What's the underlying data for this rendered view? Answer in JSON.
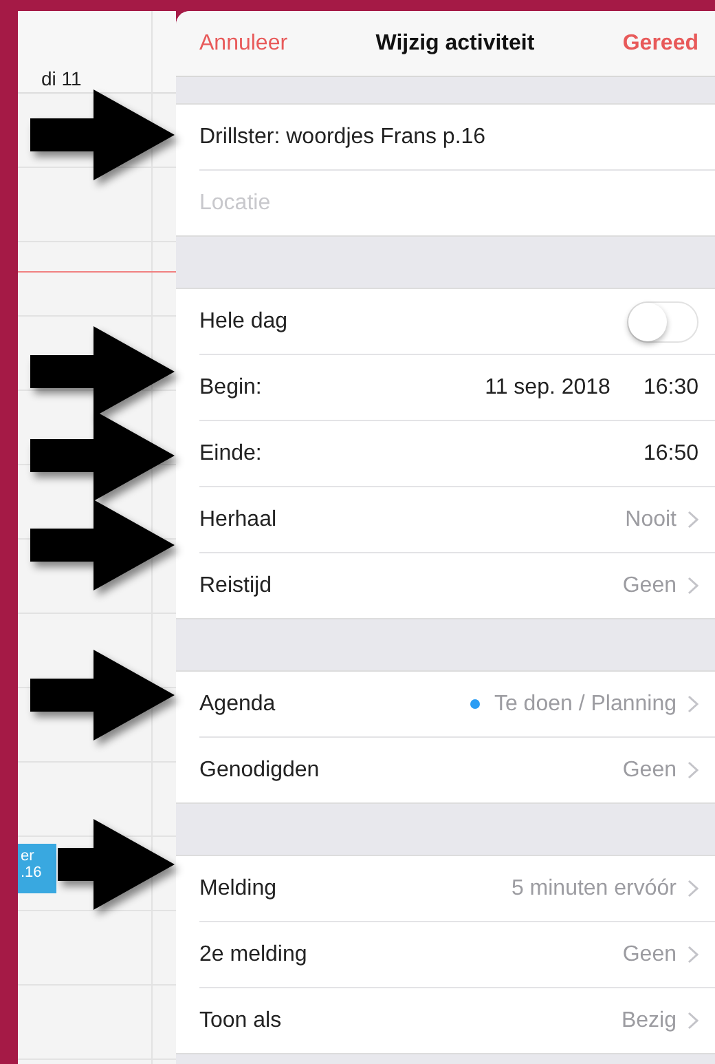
{
  "calendar": {
    "day_label": "di 11",
    "event": {
      "lines": [
        "er",
        ".16"
      ]
    }
  },
  "header": {
    "cancel": "Annuleer",
    "title": "Wijzig activiteit",
    "done": "Gereed"
  },
  "sections": [
    {
      "rows": [
        {
          "kind": "text",
          "value": "Drillster: woordjes Frans p.16"
        },
        {
          "kind": "input",
          "placeholder": "Locatie"
        }
      ]
    },
    {
      "rows": [
        {
          "kind": "switch",
          "label": "Hele dag",
          "on": false
        },
        {
          "kind": "date",
          "label": "Begin:",
          "date": "11 sep. 2018",
          "time": "16:30"
        },
        {
          "kind": "date",
          "label": "Einde:",
          "time": "16:50"
        },
        {
          "kind": "link",
          "label": "Herhaal",
          "value": "Nooit"
        },
        {
          "kind": "link",
          "label": "Reistijd",
          "value": "Geen"
        }
      ]
    },
    {
      "rows": [
        {
          "kind": "link",
          "label": "Agenda",
          "value": "Te doen / Planning",
          "color": "#2a9df4"
        },
        {
          "kind": "link",
          "label": "Genodigden",
          "value": "Geen"
        }
      ]
    },
    {
      "rows": [
        {
          "kind": "link",
          "label": "Melding",
          "value": "5 minuten ervóór"
        },
        {
          "kind": "link",
          "label": "2e melding",
          "value": "Geen"
        },
        {
          "kind": "link",
          "label": "Toon als",
          "value": "Bezig"
        }
      ]
    }
  ]
}
